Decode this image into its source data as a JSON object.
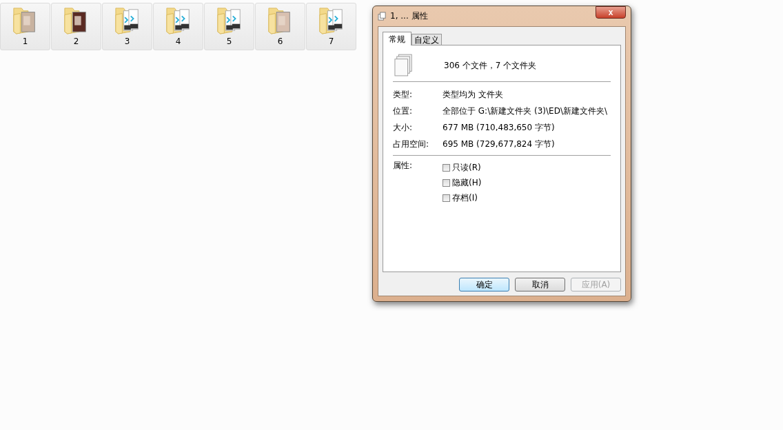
{
  "folders": [
    {
      "label": "1",
      "kind": "photo",
      "selected": false
    },
    {
      "label": "2",
      "kind": "photo",
      "selected": false
    },
    {
      "label": "3",
      "kind": "video",
      "selected": false
    },
    {
      "label": "4",
      "kind": "video",
      "selected": false
    },
    {
      "label": "5",
      "kind": "video",
      "selected": false
    },
    {
      "label": "6",
      "kind": "photo",
      "selected": false
    },
    {
      "label": "7",
      "kind": "video",
      "selected": false
    }
  ],
  "dialog": {
    "title": "1, ... 属性",
    "close": "x",
    "tabs": [
      {
        "label": "常规",
        "selected": true
      },
      {
        "label": "自定义",
        "selected": false
      }
    ],
    "summary": "306 个文件，7 个文件夹",
    "fields": [
      {
        "label": "类型:",
        "value": "类型均为 文件夹"
      },
      {
        "label": "位置:",
        "value": "全部位于 G:\\新建文件夹 (3)\\ED\\新建文件夹\\"
      },
      {
        "label": "大小:",
        "value": "677 MB (710,483,650 字节)"
      },
      {
        "label": "占用空间:",
        "value": "695 MB (729,677,824 字节)"
      }
    ],
    "attributes_label": "属性:",
    "attributes": [
      {
        "label": "只读(R)",
        "checked": false
      },
      {
        "label": "隐藏(H)",
        "checked": false
      },
      {
        "label": "存档(I)",
        "checked": false
      }
    ],
    "buttons": [
      {
        "label": "确定",
        "default": true,
        "disabled": false
      },
      {
        "label": "取消",
        "default": false,
        "disabled": false
      },
      {
        "label": "应用(A)",
        "default": false,
        "disabled": true
      }
    ]
  }
}
